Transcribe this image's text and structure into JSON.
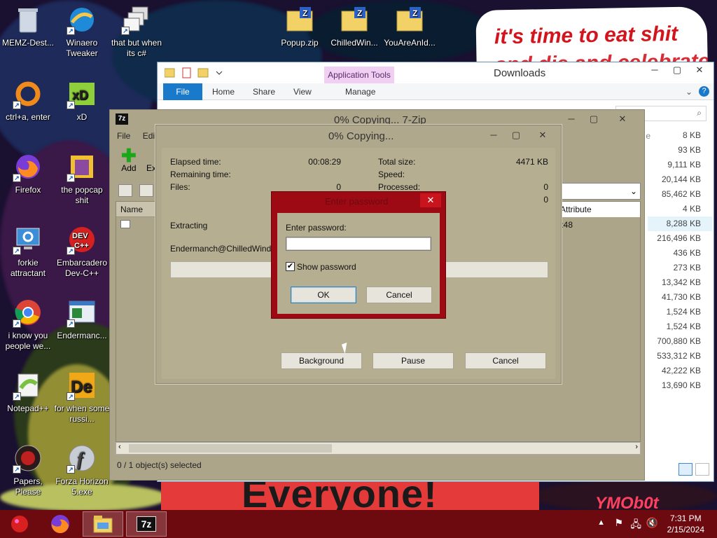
{
  "wallpaper": {
    "banner_line1": "it's time to eat shit",
    "banner_line2": "and die and celebrate",
    "bottom_text": "Everyone!",
    "corner_text": "YMOb0t"
  },
  "desktop_icons": [
    {
      "label": "MEMZ-Dest...",
      "icon": "recycle-bin-icon"
    },
    {
      "label": "Winaero Tweaker",
      "icon": "winaero-icon"
    },
    {
      "label": "that but when its c#",
      "icon": "stacked-windows-icon"
    },
    {
      "label": "Popup.zip",
      "icon": "zip-folder-icon"
    },
    {
      "label": "ChilledWin...",
      "icon": "zip-folder-icon"
    },
    {
      "label": "YouAreAnId...",
      "icon": "zip-folder-icon"
    },
    {
      "label": "ctrl+a, enter",
      "icon": "ring-icon"
    },
    {
      "label": "xD",
      "icon": "hxd-icon"
    },
    {
      "label": "Firefox",
      "icon": "firefox-icon"
    },
    {
      "label": "the popcap shit",
      "icon": "popcap-icon"
    },
    {
      "label": "forkie attractant",
      "icon": "gear-monitor-icon"
    },
    {
      "label": "Embarcadero Dev-C++",
      "icon": "devcpp-icon"
    },
    {
      "label": "i know you people we...",
      "icon": "chrome-icon"
    },
    {
      "label": "Endermanc...",
      "icon": "window-app-icon"
    },
    {
      "label": "Notepad++",
      "icon": "notepadpp-icon"
    },
    {
      "label": "for when some russi...",
      "icon": "de-icon"
    },
    {
      "label": "Papers, Please",
      "icon": "papers-please-icon"
    },
    {
      "label": "Forza Horizon 5.exe",
      "icon": "flash-icon"
    }
  ],
  "explorer": {
    "title": "Downloads",
    "app_tools": "Application Tools",
    "tabs": [
      "File",
      "Home",
      "Share",
      "View",
      "Manage"
    ],
    "search_placeholder": "",
    "sizes": [
      "8 KB",
      "93 KB",
      "9,111 KB",
      "20,144 KB",
      "85,462 KB",
      "4 KB",
      "8,288 KB",
      "216,496 KB",
      "436 KB",
      "273 KB",
      "13,342 KB",
      "41,730 KB",
      "1,524 KB",
      "1,524 KB",
      "700,880 KB",
      "533,312 KB",
      "42,222 KB",
      "13,690 KB"
    ],
    "column_fragment": "e"
  },
  "sevenzip": {
    "title": "0% Copying... 7-Zip",
    "menu": [
      "File",
      "Edit"
    ],
    "toolbar": [
      "Add",
      "Ext"
    ],
    "col_name": "Name",
    "col_attributes": "Attribute",
    "row_time_fragment": "4:48",
    "status": "0 / 1 object(s) selected"
  },
  "progress": {
    "title": "0% Copying...",
    "elapsed_label": "Elapsed time:",
    "elapsed_value": "00:08:29",
    "remaining_label": "Remaining time:",
    "files_label": "Files:",
    "files_value": "0",
    "total_label": "Total size:",
    "total_value": "4471 KB",
    "speed_label": "Speed:",
    "processed_label": "Processed:",
    "processed_value": "0",
    "extra_value": "0",
    "action": "Extracting",
    "file": "Endermanch@ChilledWindows",
    "progress_fraction": 0,
    "buttons": {
      "background": "Background",
      "pause": "Pause",
      "cancel": "Cancel"
    }
  },
  "password_dialog": {
    "title": "Enter password",
    "prompt": "Enter password:",
    "value": "",
    "show_password_label": "Show password",
    "show_password_checked": true,
    "ok": "OK",
    "cancel": "Cancel"
  },
  "taskbar": {
    "time": "7:31 PM",
    "date": "2/15/2024",
    "pinned": [
      "start-orb-icon",
      "firefox-icon",
      "file-explorer-icon",
      "7zip-icon"
    ]
  },
  "colors": {
    "taskbar": "#6c0a10",
    "dialog_red": "#9e0a14",
    "dialog_body": "#b5ae91",
    "ribbon_file": "#1979ca"
  }
}
